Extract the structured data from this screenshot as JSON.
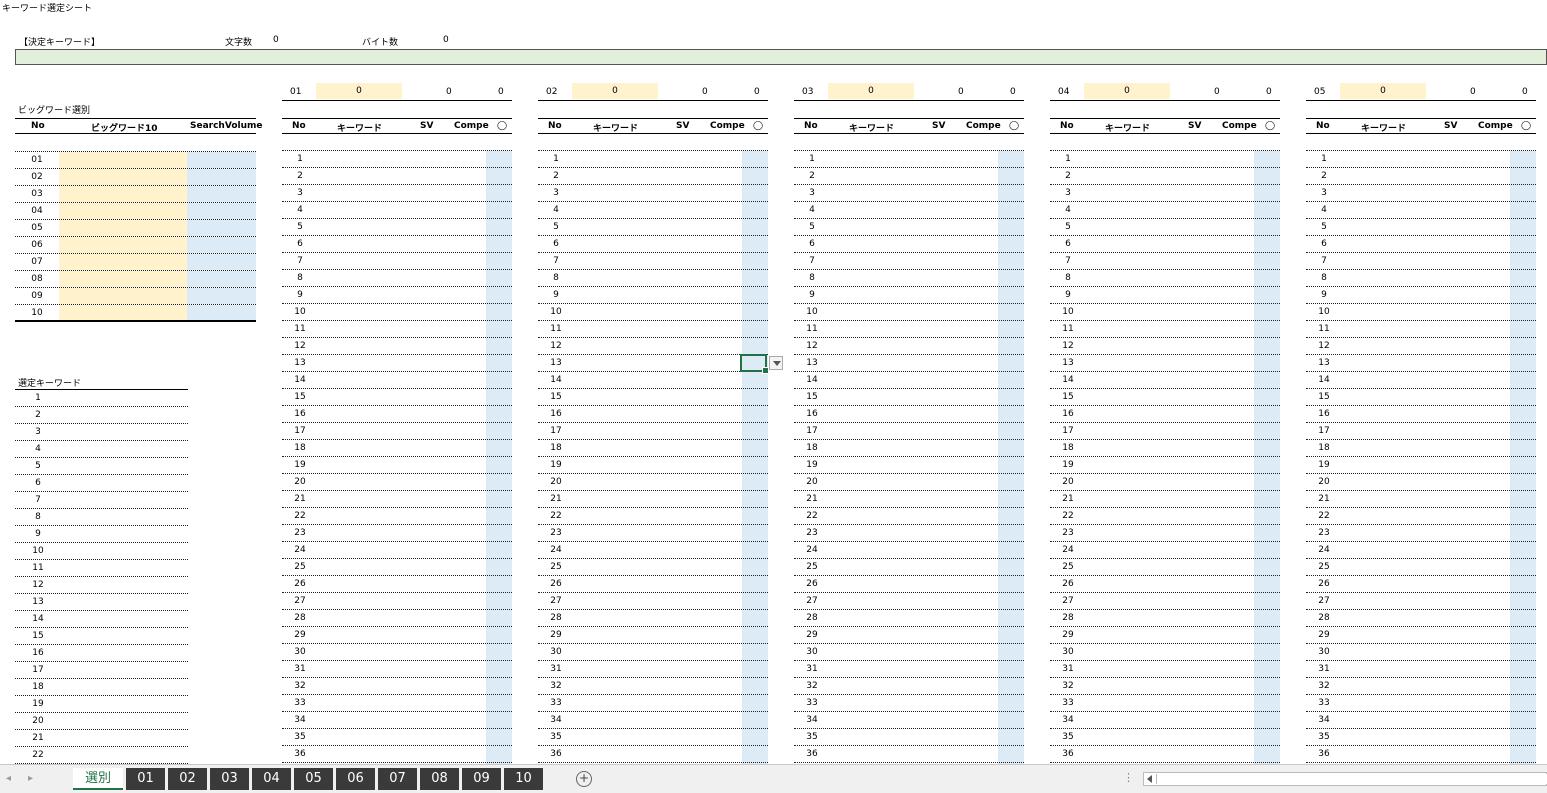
{
  "sheet_title": "キーワード選定シート",
  "decision": {
    "label": "【決定キーワード】",
    "char_count_label": "文字数",
    "char_count": "0",
    "byte_count_label": "バイト数",
    "byte_count": "0"
  },
  "bigword": {
    "section_label": "ビッグワード選別",
    "headers": {
      "no": "No",
      "word": "ビッグワード10",
      "sv": "SearchVolume"
    },
    "rows": [
      "01",
      "02",
      "03",
      "04",
      "05",
      "06",
      "07",
      "08",
      "09",
      "10"
    ]
  },
  "selected": {
    "label": "選定キーワード",
    "rows": [
      "1",
      "2",
      "3",
      "4",
      "5",
      "6",
      "7",
      "8",
      "9",
      "10",
      "11",
      "12",
      "13",
      "14",
      "15",
      "16",
      "17",
      "18",
      "19",
      "20",
      "21",
      "22"
    ]
  },
  "kw_tables": [
    {
      "id": "01",
      "count": "0",
      "v1": "0",
      "v2": "0"
    },
    {
      "id": "02",
      "count": "0",
      "v1": "0",
      "v2": "0"
    },
    {
      "id": "03",
      "count": "0",
      "v1": "0",
      "v2": "0"
    },
    {
      "id": "04",
      "count": "0",
      "v1": "0",
      "v2": "0"
    },
    {
      "id": "05",
      "count": "0",
      "v1": "0",
      "v2": "0"
    }
  ],
  "kw_headers": {
    "no": "No",
    "keyword": "キーワード",
    "sv": "SV",
    "compe": "Compe",
    "mark": "◯"
  },
  "kw_rows": [
    "1",
    "2",
    "3",
    "4",
    "5",
    "6",
    "7",
    "8",
    "9",
    "10",
    "11",
    "12",
    "13",
    "14",
    "15",
    "16",
    "17",
    "18",
    "19",
    "20",
    "21",
    "22",
    "23",
    "24",
    "25",
    "26",
    "27",
    "28",
    "29",
    "30",
    "31",
    "32",
    "33",
    "34",
    "35",
    "36"
  ],
  "tabs": [
    {
      "label": "選別",
      "active": true
    },
    {
      "label": "01"
    },
    {
      "label": "02"
    },
    {
      "label": "03"
    },
    {
      "label": "04"
    },
    {
      "label": "05"
    },
    {
      "label": "06"
    },
    {
      "label": "07"
    },
    {
      "label": "08"
    },
    {
      "label": "09"
    },
    {
      "label": "10"
    }
  ],
  "colors": {
    "accent": "#217346",
    "yellow_fill": "#fff2cc",
    "blue_fill": "#ddebf7",
    "green_bar": "#e2efda"
  }
}
